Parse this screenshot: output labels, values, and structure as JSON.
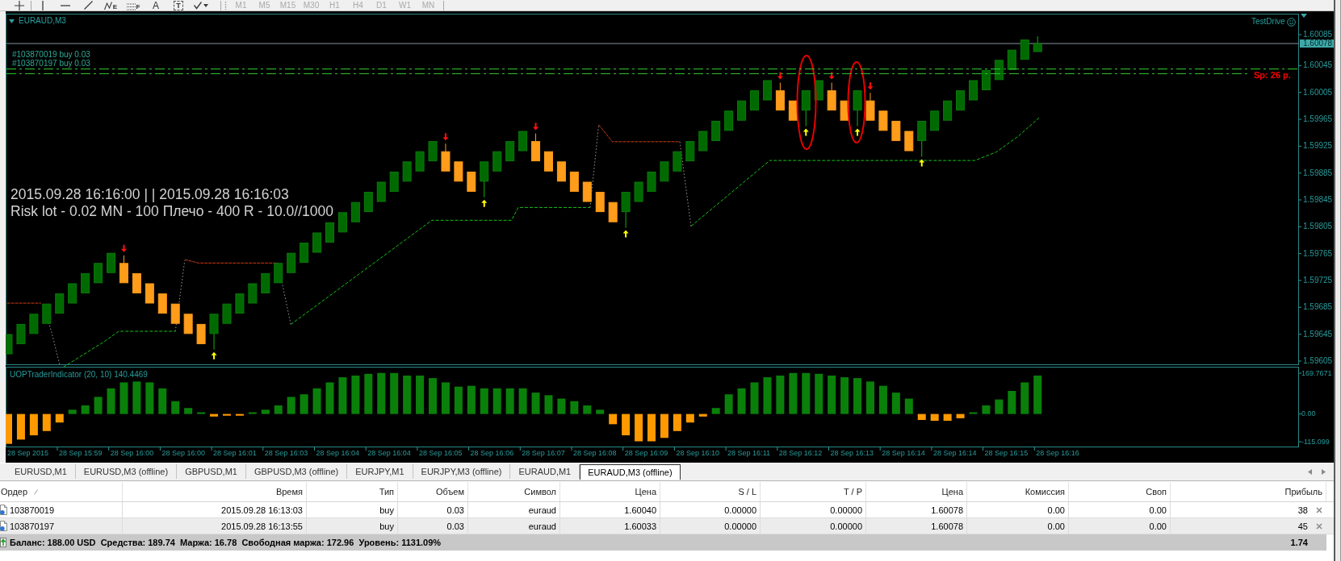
{
  "toolbar": {
    "tools": [
      {
        "kind": "crosshair"
      },
      {
        "kind": "vertical-line"
      },
      {
        "kind": "horizontal-line"
      },
      {
        "kind": "trend-line"
      },
      {
        "kind": "fibo-expansion",
        "letter": "E"
      },
      {
        "kind": "fibo-levels",
        "letter": "F"
      },
      {
        "kind": "text",
        "letter": "A"
      },
      {
        "kind": "label",
        "letter": "T"
      },
      {
        "kind": "arrows"
      }
    ],
    "timeframes": [
      {
        "label": "M1",
        "disabled": true
      },
      {
        "label": "M5",
        "disabled": true
      },
      {
        "label": "M15",
        "disabled": true
      },
      {
        "label": "M30",
        "disabled": true
      },
      {
        "label": "H1",
        "disabled": true
      },
      {
        "label": "H4",
        "disabled": true
      },
      {
        "label": "D1",
        "disabled": true
      },
      {
        "label": "W1",
        "disabled": true
      },
      {
        "label": "MN",
        "disabled": true
      }
    ]
  },
  "chart": {
    "title": "EURAUD,M3",
    "account": "TestDrive",
    "order_lines": [
      {
        "label": "#103870019 buy 0.03"
      },
      {
        "label": "#103870197 buy 0.03"
      }
    ],
    "spread": "Sp: 26 p.",
    "info_lines": [
      "2015.09.28 16:16:00 | | 2015.09.28 16:16:03",
      "Risk lot - 0.02 MN - 100 Плечо - 400 R - 10.0//1000"
    ],
    "price_axis": [
      "1.60085",
      "1.60045",
      "1.60005",
      "1.59965",
      "1.59925",
      "1.59885",
      "1.59845",
      "1.59805",
      "1.59765",
      "1.59725",
      "1.59685",
      "1.59645",
      "1.59605"
    ],
    "current_price": "1.60078",
    "indicator": {
      "title": "UOPTraderIndicator (20, 10) 140.4469",
      "axis": [
        "169.7671",
        "0.00",
        "-115.099"
      ]
    },
    "time_axis": [
      "28 Sep 2015",
      "28 Sep 15:59",
      "28 Sep 16:00",
      "28 Sep 16:00",
      "28 Sep 16:01",
      "28 Sep 16:03",
      "28 Sep 16:04",
      "28 Sep 16:04",
      "28 Sep 16:05",
      "28 Sep 16:06",
      "28 Sep 16:07",
      "28 Sep 16:08",
      "28 Sep 16:09",
      "28 Sep 16:10",
      "28 Sep 16:11",
      "28 Sep 16:12",
      "28 Sep 16:13",
      "28 Sep 16:14",
      "28 Sep 16:14",
      "28 Sep 16:15",
      "28 Sep 16:16"
    ]
  },
  "tabs": [
    {
      "label": "EURUSD,M1",
      "selected": false
    },
    {
      "label": "EURUSD,M3 (offline)",
      "selected": false
    },
    {
      "label": "GBPUSD,M1",
      "selected": false
    },
    {
      "label": "GBPUSD,M3 (offline)",
      "selected": false
    },
    {
      "label": "EURJPY,M1",
      "selected": false
    },
    {
      "label": "EURJPY,M3 (offline)",
      "selected": false
    },
    {
      "label": "EURAUD,M1",
      "selected": false
    },
    {
      "label": "EURAUD,M3 (offline)",
      "selected": true
    }
  ],
  "table": {
    "columns": [
      "Ордер",
      "Время",
      "Тип",
      "Объем",
      "Символ",
      "Цена",
      "S / L",
      "T / P",
      "Цена",
      "Комиссия",
      "Своп",
      "Прибыль"
    ],
    "rows": [
      {
        "cells": [
          "103870019",
          "2015.09.28 16:13:03",
          "buy",
          "0.03",
          "euraud",
          "1.60040",
          "0.00000",
          "0.00000",
          "1.60078",
          "0.00",
          "0.00",
          "38"
        ]
      },
      {
        "cells": [
          "103870197",
          "2015.09.28 16:13:55",
          "buy",
          "0.03",
          "euraud",
          "1.60033",
          "0.00000",
          "0.00000",
          "1.60078",
          "0.00",
          "0.00",
          "45"
        ]
      }
    ],
    "summary": "Баланс: 188.00 USD  Средства: 189.74  Маржа: 16.78  Свободная маржа: 172.96  Уровень: 1131.09%",
    "total": "1.74"
  }
}
